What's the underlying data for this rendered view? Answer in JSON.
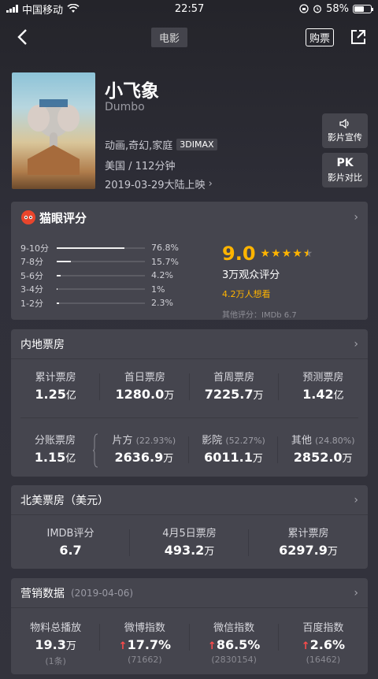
{
  "status": {
    "carrier": "中国移动",
    "time": "22:57",
    "battery": "58%",
    "battery_level": 0.58
  },
  "nav": {
    "title": "电影",
    "buy": "购票"
  },
  "movie": {
    "title": "小飞象",
    "en_title": "Dumbo",
    "genre": "动画,奇幻,家庭",
    "format": "3DIMAX",
    "country_duration": "美国 / 112分钟",
    "release": "2019-03-29大陆上映",
    "btn_promo": "影片宣传",
    "btn_pk_top": "PK",
    "btn_pk": "影片对比"
  },
  "rating": {
    "title": "猫眼评分",
    "distribution": [
      {
        "label": "9-10分",
        "pct": "76.8%",
        "value": 0.768
      },
      {
        "label": "7-8分",
        "pct": "15.7%",
        "value": 0.157
      },
      {
        "label": "5-6分",
        "pct": "4.2%",
        "value": 0.042
      },
      {
        "label": "3-4分",
        "pct": "1%",
        "value": 0.01
      },
      {
        "label": "1-2分",
        "pct": "2.3%",
        "value": 0.023
      }
    ],
    "score": "9.0",
    "stars": 4.5,
    "count": "3万观众评分",
    "want": "4.2万人想看",
    "other": "其他评分：IMDb 6.7"
  },
  "domestic": {
    "title": "内地票房",
    "row1": [
      {
        "label": "累计票房",
        "num": "1.25",
        "unit": "亿"
      },
      {
        "label": "首日票房",
        "num": "1280.0",
        "unit": "万"
      },
      {
        "label": "首周票房",
        "num": "7225.7",
        "unit": "万"
      },
      {
        "label": "预测票房",
        "num": "1.42",
        "unit": "亿"
      }
    ],
    "split": {
      "label": "分账票房",
      "num": "1.15",
      "unit": "亿"
    },
    "row2": [
      {
        "label": "片方",
        "pct": "(22.93%)",
        "num": "2636.9",
        "unit": "万"
      },
      {
        "label": "影院",
        "pct": "(52.27%)",
        "num": "6011.1",
        "unit": "万"
      },
      {
        "label": "其他",
        "pct": "(24.80%)",
        "num": "2852.0",
        "unit": "万"
      }
    ]
  },
  "na": {
    "title": "北美票房（美元）",
    "cells": [
      {
        "label": "IMDB评分",
        "num": "6.7",
        "unit": ""
      },
      {
        "label": "4月5日票房",
        "num": "493.2",
        "unit": "万"
      },
      {
        "label": "累计票房",
        "num": "6297.9",
        "unit": "万"
      }
    ]
  },
  "marketing": {
    "title": "营销数据",
    "date": "(2019-04-06)",
    "cells": [
      {
        "label": "物料总播放",
        "num": "19.3",
        "unit": "万",
        "sub": "(1条)",
        "up": false
      },
      {
        "label": "微博指数",
        "num": "17.7%",
        "unit": "",
        "sub": "(71662)",
        "up": true
      },
      {
        "label": "微信指数",
        "num": "86.5%",
        "unit": "",
        "sub": "(2830154)",
        "up": true
      },
      {
        "label": "百度指数",
        "num": "2.6%",
        "unit": "",
        "sub": "(16462)",
        "up": true
      }
    ]
  },
  "colors": {
    "accent": "#ffb400",
    "up": "#ff4b4b",
    "card": "#45454e"
  }
}
